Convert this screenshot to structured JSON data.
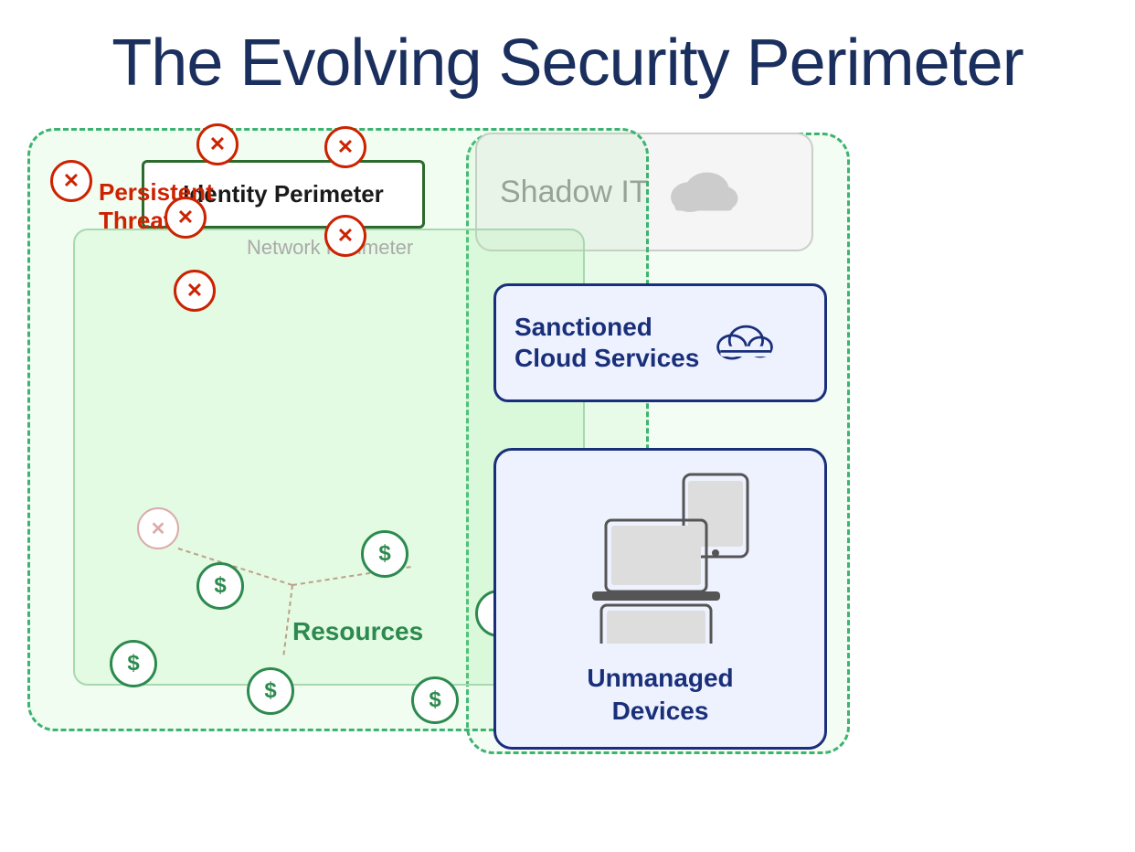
{
  "title": "The Evolving Security Perimeter",
  "labels": {
    "shadow_it": "Shadow IT",
    "identity_perimeter": "Identity Perimeter",
    "network_perimeter": "Network Perimeter",
    "sanctioned_cloud": "Sanctioned\nCloud Services",
    "sanctioned_cloud_line1": "Sanctioned",
    "sanctioned_cloud_line2": "Cloud Services",
    "unmanaged_devices_line1": "Unmanaged",
    "unmanaged_devices_line2": "Devices",
    "persistent_threats_line1": "Persistent",
    "persistent_threats_line2": "Threats",
    "resources": "Resources"
  },
  "colors": {
    "title": "#1a2f5e",
    "threat_red": "#cc2200",
    "green_border": "#3cb371",
    "green_resource": "#2d8a4e",
    "navy_blue": "#1a2f7a",
    "shadow_gray": "#999",
    "network_gray": "#aaa"
  }
}
